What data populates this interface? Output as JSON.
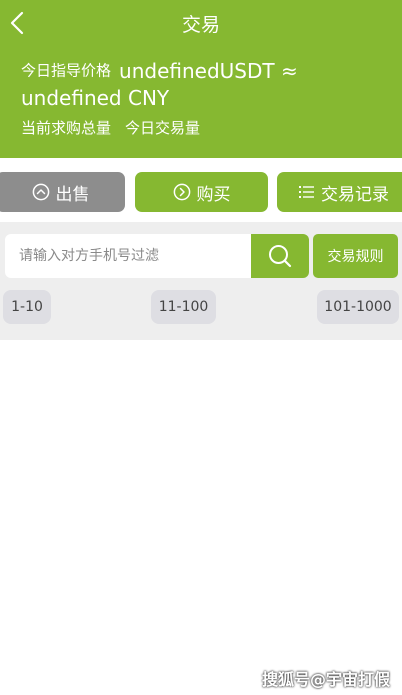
{
  "header": {
    "title": "交易",
    "price_label": "今日指导价格",
    "price_value_usdt": "undefinedUSDT ≈",
    "price_value_cny": "undefined CNY",
    "total_buy_label": "当前求购总量",
    "today_volume_label": "今日交易量"
  },
  "tabs": [
    {
      "label": "出售",
      "icon": "up-circle-icon"
    },
    {
      "label": "购买",
      "icon": "right-circle-icon"
    },
    {
      "label": "交易记录",
      "icon": "list-icon"
    }
  ],
  "search": {
    "placeholder": "请输入对方手机号过滤",
    "value": ""
  },
  "rules_label": "交易规则",
  "ranges": [
    "1-10",
    "11-100",
    "101-1000"
  ],
  "watermark": "搜狐号@宇宙打假",
  "colors": {
    "accent": "#86b831",
    "inactive_tab": "#8d8d8d",
    "filter_bg": "#eeeeee",
    "chip_bg": "#dedee3"
  }
}
